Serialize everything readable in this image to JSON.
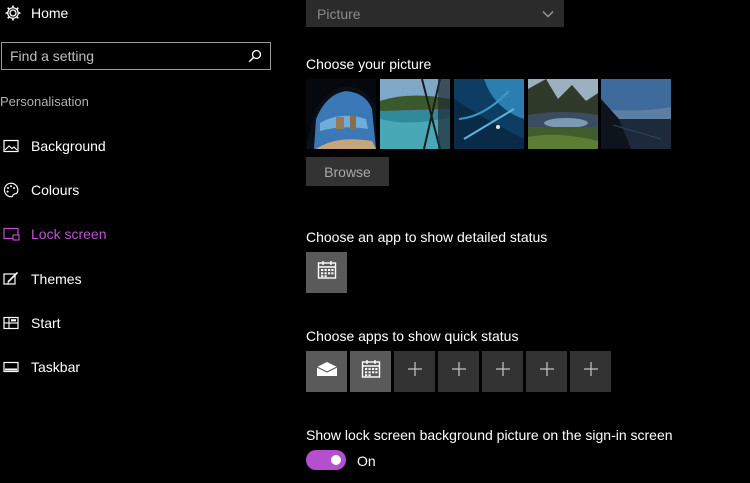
{
  "sidebar": {
    "home_label": "Home",
    "search_placeholder": "Find a setting",
    "section_title": "Personalisation",
    "items": [
      {
        "label": "Background",
        "icon": "picture-icon"
      },
      {
        "label": "Colours",
        "icon": "palette-icon"
      },
      {
        "label": "Lock screen",
        "icon": "lock-screen-icon"
      },
      {
        "label": "Themes",
        "icon": "brush-icon"
      },
      {
        "label": "Start",
        "icon": "start-icon"
      },
      {
        "label": "Taskbar",
        "icon": "taskbar-icon"
      }
    ],
    "active_color": "#c04fd6"
  },
  "main": {
    "background_dropdown_value": "Picture",
    "choose_picture_heading": "Choose your picture",
    "browse_label": "Browse",
    "detailed_status_heading": "Choose an app to show detailed status",
    "quick_status_heading": "Choose apps to show quick status",
    "signin_heading": "Show lock screen background picture on the sign-in screen",
    "toggle_state": "On",
    "toggle_color": "#b44fd0"
  }
}
